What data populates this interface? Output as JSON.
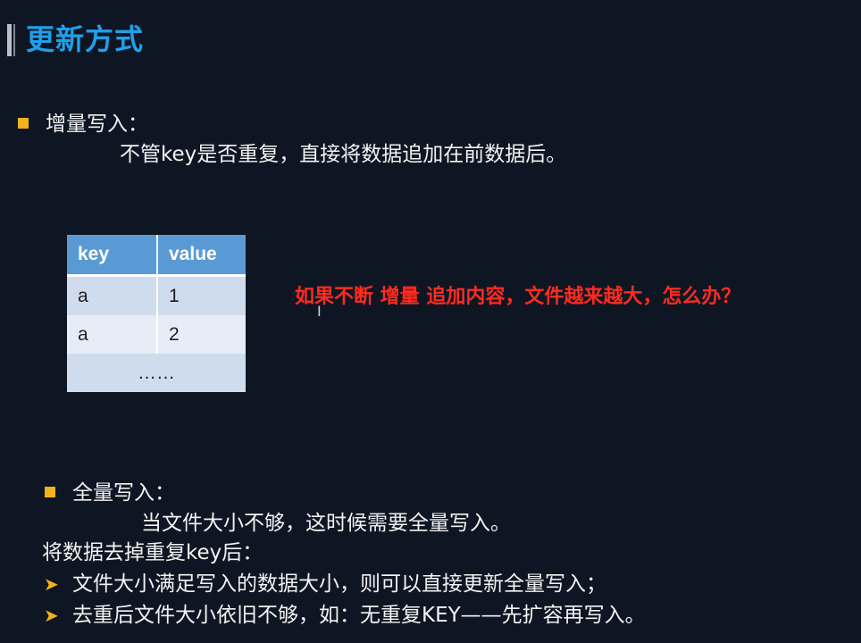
{
  "title": "更新方式",
  "section1": {
    "heading": "增量写入：",
    "description": "不管key是否重复，直接将数据追加在前数据后。"
  },
  "table": {
    "headers": [
      "key",
      "value"
    ],
    "rows": [
      [
        "a",
        "1"
      ],
      [
        "a",
        "2"
      ]
    ],
    "ellipsis": "……"
  },
  "question": "如果不断 增量 追加内容，文件越来越大，怎么办？",
  "section2": {
    "heading": "全量写入：",
    "description": "当文件大小不够，这时候需要全量写入。",
    "note": "将数据去掉重复key后：",
    "points": [
      "文件大小满足写入的数据大小，则可以直接更新全量写入；",
      "去重后文件大小依旧不够，如：无重复KEY——先扩容再写入。"
    ]
  },
  "colors": {
    "background": "#0f1623",
    "title": "#1fa0ea",
    "bullet": "#f2b21b",
    "question": "#ff2b20",
    "table_header": "#5a9ad4"
  }
}
